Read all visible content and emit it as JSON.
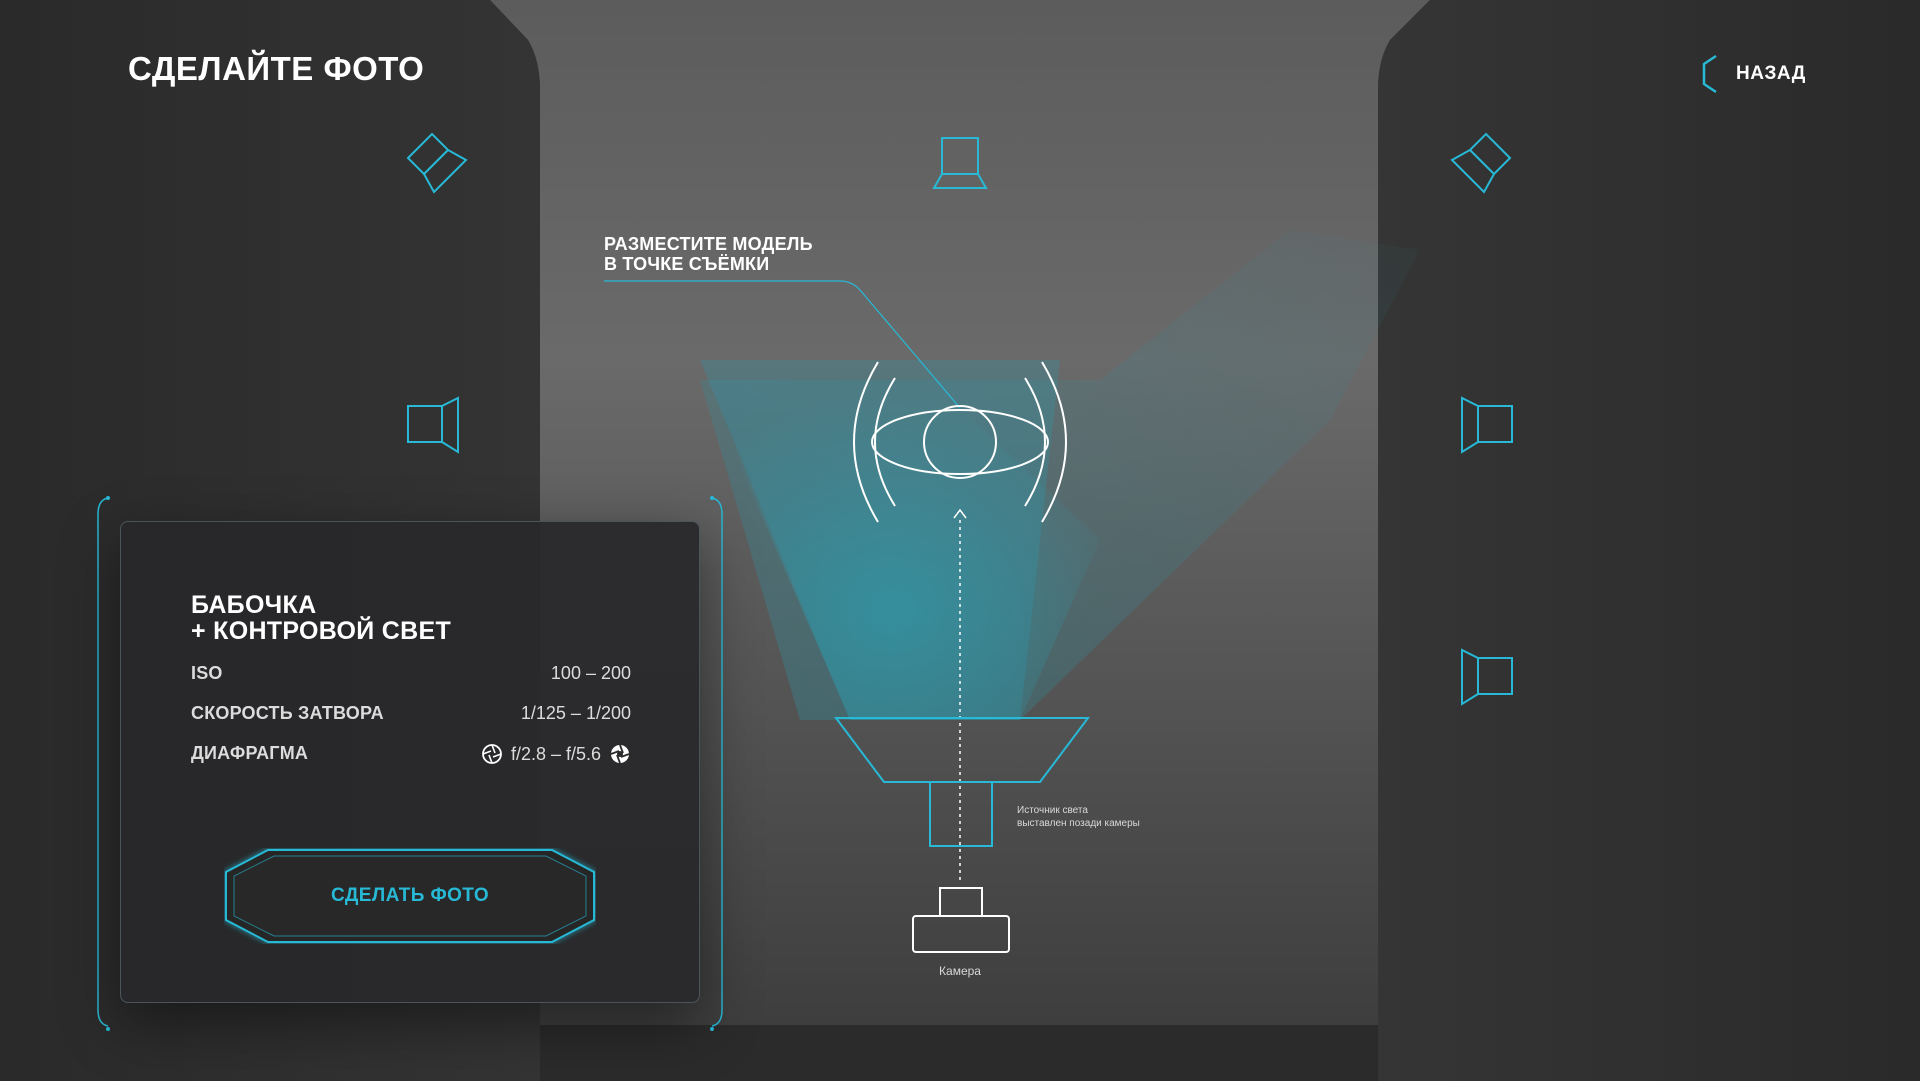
{
  "header": {
    "title": "СДЕЛАЙТЕ ФОТО",
    "back_label": "НАЗАД"
  },
  "diagram": {
    "callout_line1": "РАЗМЕСТИТЕ МОДЕЛЬ",
    "callout_line2": "В ТОЧКЕ СЪЁМКИ",
    "light_note_line1": "Источник света",
    "light_note_line2": "выставлен позади камеры",
    "camera_label": "Камера"
  },
  "card": {
    "title_line1": "БАБОЧКА",
    "title_line2": "+ КОНТРОВОЙ СВЕТ",
    "settings": [
      {
        "label": "ISO",
        "value": "100 – 200"
      },
      {
        "label": "СКОРОСТЬ ЗАТВОРА",
        "value": "1/125 – 1/200"
      },
      {
        "label": "ДИАФРАГМА",
        "value": "f/2.8 – f/5.6"
      }
    ],
    "button_label": "СДЕЛАТЬ ФОТО"
  },
  "colors": {
    "accent": "#27b9d6",
    "background": "#2b2b2b",
    "studio_floor": "#6a6a6a"
  },
  "icons": {
    "back": "chevron-left-icon",
    "light_source": "softbox-light-icon",
    "aperture": "aperture-icon",
    "camera": "camera-icon",
    "model": "model-position-icon"
  }
}
